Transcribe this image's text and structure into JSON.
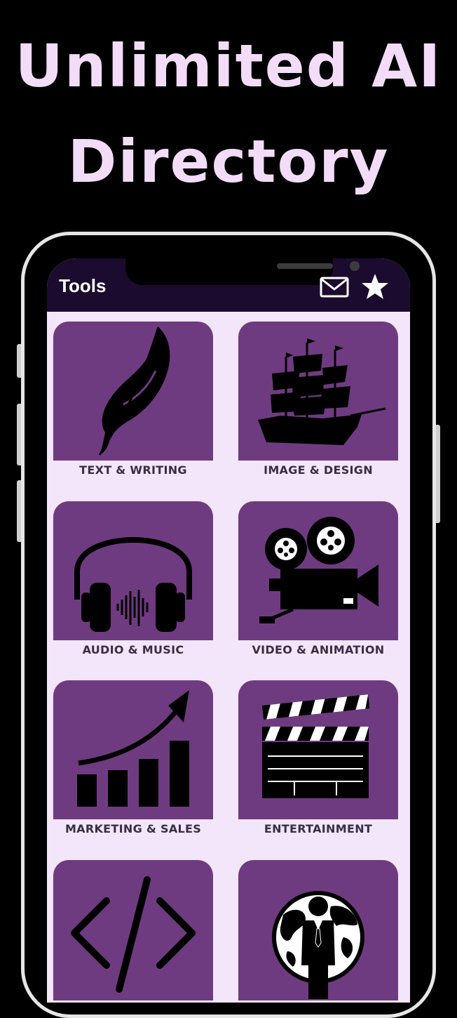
{
  "promo": {
    "headline_line1": "Unlimited AI",
    "headline_line2": "Directory"
  },
  "app": {
    "title": "Tools",
    "actions": [
      "mail-icon",
      "star-icon"
    ]
  },
  "categories": [
    {
      "label": "TEXT & WRITING",
      "icon": "feather-icon"
    },
    {
      "label": "IMAGE & DESIGN",
      "icon": "ship-icon"
    },
    {
      "label": "AUDIO & MUSIC",
      "icon": "headphones-icon"
    },
    {
      "label": "VIDEO & ANIMATION",
      "icon": "film-camera-icon"
    },
    {
      "label": "MARKETING & SALES",
      "icon": "growth-chart-icon"
    },
    {
      "label": "ENTERTAINMENT",
      "icon": "clapperboard-icon"
    },
    {
      "label": "",
      "icon": "code-icon"
    },
    {
      "label": "",
      "icon": "globe-businessman-icon"
    }
  ],
  "colors": {
    "background": "#000000",
    "headline": "#f2dcf7",
    "appbar": "#1b0b2e",
    "card": "#6f3b80",
    "screen": "#f3e6fb"
  }
}
